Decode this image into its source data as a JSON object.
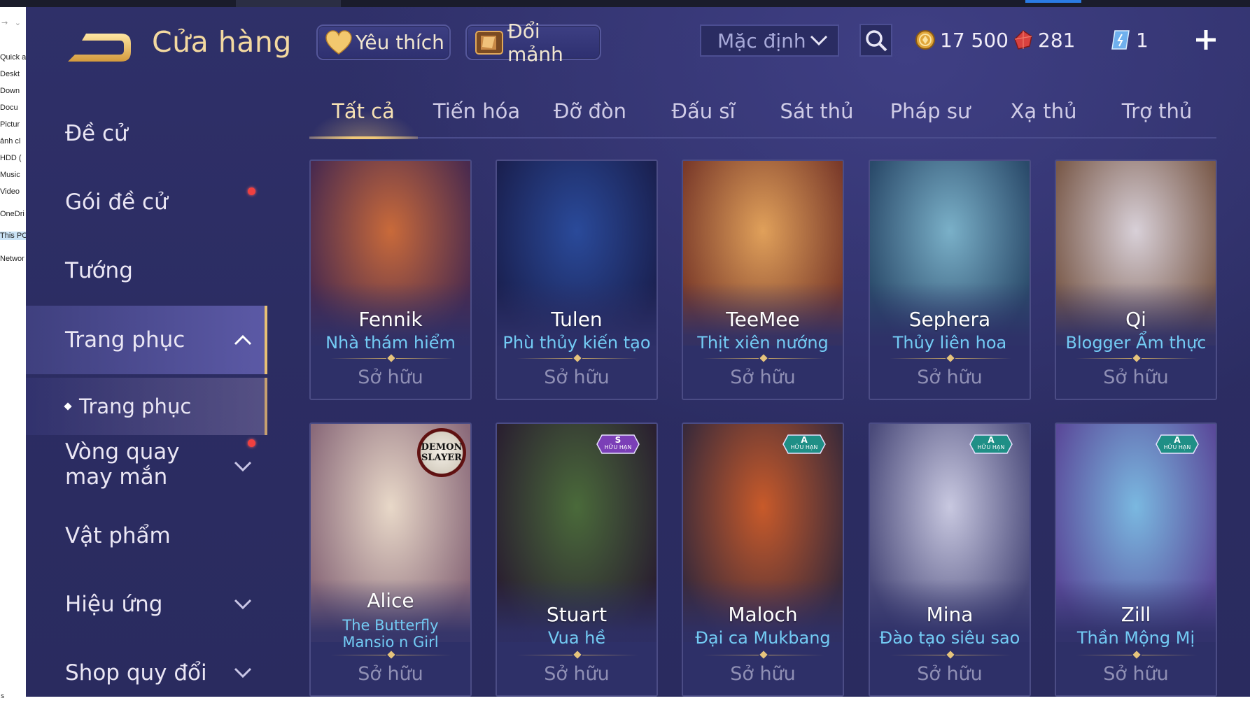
{
  "explorer": {
    "items": [
      "Quick a",
      "Deskt",
      "Down",
      "Docu",
      "Pictur",
      "ảnh cl",
      "HDD (",
      "Music",
      "Video",
      "OneDri",
      "This PC",
      "Networ"
    ],
    "bottom_char": "s"
  },
  "header": {
    "title": "Cửa hàng",
    "favorites_label": "Yêu thích",
    "swap_label": "Đổi mảnh",
    "sort_value": "Mặc định",
    "gold": "17 500",
    "ruby": "281",
    "voucher": "1"
  },
  "sidebar": {
    "items": [
      {
        "label": "Đề cử"
      },
      {
        "label": "Gói đề cử"
      },
      {
        "label": "Tướng"
      },
      {
        "label": "Trang phục"
      },
      {
        "label": "Trang phục"
      },
      {
        "label": "Vòng quay may mắn"
      },
      {
        "label": "Vật phẩm"
      },
      {
        "label": "Hiệu ứng"
      },
      {
        "label": "Shop quy đổi"
      }
    ]
  },
  "tabs": [
    "Tất cả",
    "Tiến hóa",
    "Đỡ đòn",
    "Đấu sĩ",
    "Sát thủ",
    "Pháp sư",
    "Xạ thủ",
    "Trợ thủ"
  ],
  "cards": [
    {
      "hero": "Fennik",
      "skin": "Nhà thám hiểm",
      "status": "Sở hữu"
    },
    {
      "hero": "Tulen",
      "skin": "Phù thủy kiến tạo",
      "status": "Sở hữu"
    },
    {
      "hero": "TeeMee",
      "skin": "Thịt xiên nướng",
      "status": "Sở hữu"
    },
    {
      "hero": "Sephera",
      "skin": "Thủy liên hoa",
      "status": "Sở hữu"
    },
    {
      "hero": "Qi",
      "skin": "Blogger Ẩm thực",
      "status": "Sở hữu"
    },
    {
      "hero": "Alice",
      "skin": "The Butterfly Mansio n Girl",
      "status": "Sở hữu",
      "logo": [
        "DEMON",
        "SLAYER"
      ]
    },
    {
      "hero": "Stuart",
      "skin": "Vua hề",
      "status": "Sở hữu",
      "badge": {
        "tier": "S",
        "text": "HỮU HẠN"
      }
    },
    {
      "hero": "Maloch",
      "skin": "Đại ca Mukbang",
      "status": "Sở hữu",
      "badge": {
        "tier": "A",
        "text": "HỮU HẠN"
      }
    },
    {
      "hero": "Mina",
      "skin": "Đào tạo siêu sao",
      "status": "Sở hữu",
      "badge": {
        "tier": "A",
        "text": "HỮU HẠN"
      }
    },
    {
      "hero": "Zill",
      "skin": "Thần Mộng Mị",
      "status": "Sở hữu",
      "badge": {
        "tier": "A",
        "text": "HỮU HẠN"
      }
    }
  ],
  "colors": {
    "background": "#2c2d63",
    "accent_gold": "#f0c878",
    "skin_blue": "#73cbf4",
    "notification_red": "#f04040",
    "badge_a": "#1f8f86",
    "badge_s": "#7b3fb7"
  }
}
